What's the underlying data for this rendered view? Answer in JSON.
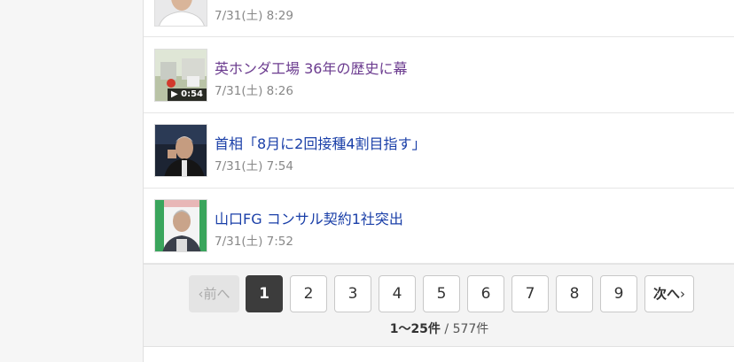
{
  "news": [
    {
      "title": "",
      "date": "7/31(土) 8:29",
      "visited": false,
      "thumb": "portrait-man-white",
      "video": ""
    },
    {
      "title": "英ホンダ工場 36年の歴史に幕",
      "date": "7/31(土) 8:26",
      "visited": true,
      "thumb": "factory",
      "video": "▶ 0:54"
    },
    {
      "title": "首相「8月に2回接種4割目指す」",
      "date": "7/31(土) 7:54",
      "visited": false,
      "thumb": "prime-minister",
      "video": ""
    },
    {
      "title": "山口FG コンサル契約1社突出",
      "date": "7/31(土) 7:52",
      "visited": false,
      "thumb": "press-conference",
      "video": ""
    }
  ],
  "pager": {
    "prev": "前へ",
    "pages": [
      "1",
      "2",
      "3",
      "4",
      "5",
      "6",
      "7",
      "8",
      "9"
    ],
    "current": "1",
    "next": "次へ"
  },
  "results": {
    "range": "1〜25件",
    "separator": " / ",
    "total": "577件"
  }
}
